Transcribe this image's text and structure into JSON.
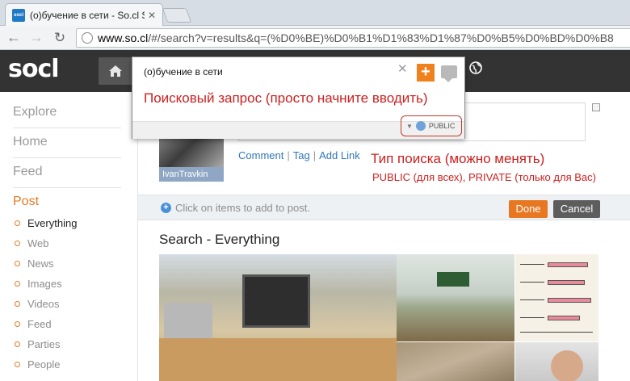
{
  "browser": {
    "tab_title": "(о)бучение в сети - So.cl S",
    "tab_close": "✕",
    "favicon_text": "socl",
    "url_host": "www.so.cl",
    "url_path": "/#/search?v=results&q=(%D0%BE)%D0%B1%D1%83%D1%87%D0%B5%D0%BD%D0%B8"
  },
  "header": {
    "logo": "socl"
  },
  "sidebar": {
    "items": [
      "Explore",
      "Home",
      "Feed",
      "Post"
    ],
    "filters": [
      "Everything",
      "Web",
      "News",
      "Images",
      "Videos",
      "Feed",
      "Parties",
      "People"
    ],
    "active_filter": "Everything"
  },
  "popup": {
    "query": "(о)бучение в сети",
    "close": "✕",
    "add": "+",
    "hint": "Поисковый запрос (просто начните вводить)",
    "visibility": "PUBLIC"
  },
  "profile": {
    "name": "IvanTravkin"
  },
  "actions": {
    "comment": "Comment",
    "tag": "Tag",
    "add_link": "Add Link",
    "separator": "|"
  },
  "annotation": {
    "title": "Тип поиска (можно менять)",
    "subtitle": "PUBLIC (для всех), PRIVATE (только для Вас)"
  },
  "addbar": {
    "hint": "Click on items to add to post.",
    "done": "Done",
    "cancel": "Cancel"
  },
  "results": {
    "title": "Search - Everything"
  },
  "colors": {
    "accent": "#e87722",
    "header_bg": "#333333",
    "annotation": "#cc1f1f",
    "link": "#2f78b6"
  }
}
